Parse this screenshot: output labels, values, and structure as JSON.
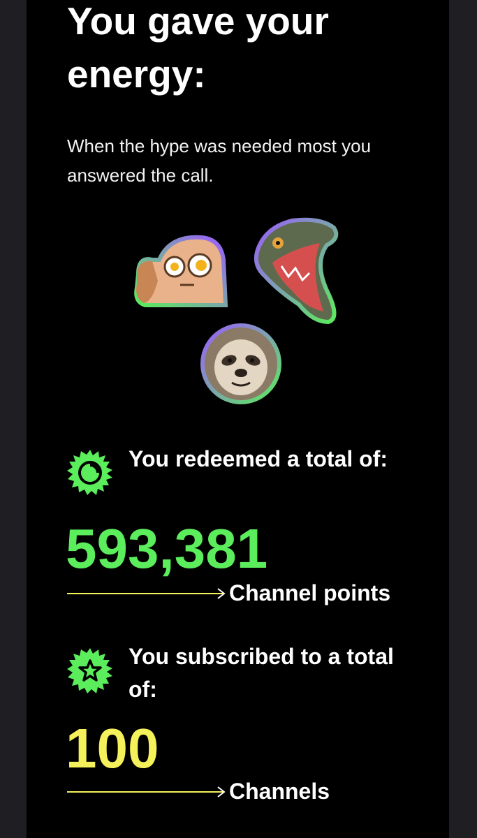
{
  "recap": {
    "headline": "You gave your energy:",
    "subline": "When the hype was needed most you answered the call."
  },
  "emotes": [
    {
      "name": "peeking-emote",
      "border": "green-purple"
    },
    {
      "name": "hype-dinosaur-emote",
      "border": "purple-green"
    },
    {
      "name": "sloth-emote",
      "border": "purple-green"
    }
  ],
  "stats": {
    "points": {
      "title": "You redeemed a total of:",
      "value": "593,381",
      "unit": "Channel points",
      "icon": "channel-points-icon",
      "color": "#5bed5b"
    },
    "subs": {
      "title": "You subscribed to a total of:",
      "value": "100",
      "unit": "Channels",
      "icon": "star-icon",
      "color": "#f5f15a"
    }
  },
  "colors": {
    "background": "#000000",
    "frame": "#1f1f23",
    "accent_green": "#5bed5b",
    "accent_yellow": "#f5f15a",
    "arrow": "#f5f15a"
  }
}
